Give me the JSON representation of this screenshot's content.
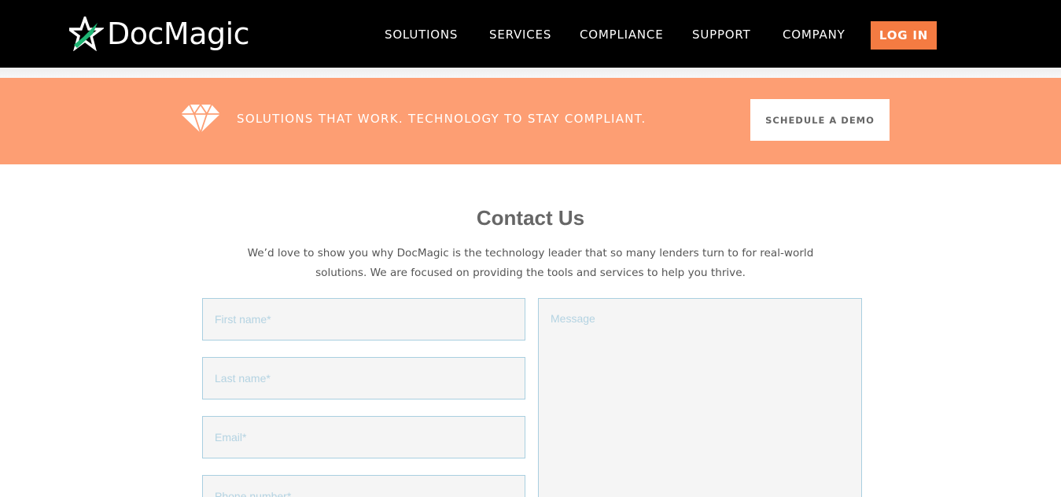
{
  "header": {
    "brand": "DocMagic",
    "nav": [
      "SOLUTIONS",
      "SERVICES",
      "COMPLIANCE",
      "SUPPORT",
      "COMPANY"
    ],
    "login_label": "LOG IN"
  },
  "banner": {
    "icon": "diamond-icon",
    "tagline": "SOLUTIONS THAT WORK. TECHNOLOGY TO STAY COMPLIANT.",
    "demo_label": "SCHEDULE A DEMO"
  },
  "contact": {
    "title": "Contact Us",
    "description": "We’d love to show you why DocMagic is the technology leader that so many lenders turn to for real-world solutions. We are focused on providing the tools and services to help you thrive.",
    "fields": {
      "first_name": "First name*",
      "last_name": "Last name*",
      "email": "Email*",
      "phone": "Phone number*",
      "message": "Message"
    }
  },
  "colors": {
    "header_bg": "#000000",
    "accent": "#f47b42",
    "banner_bg": "#fd9e73",
    "logo_green": "#1fb574",
    "field_border": "#a9cfe0"
  }
}
